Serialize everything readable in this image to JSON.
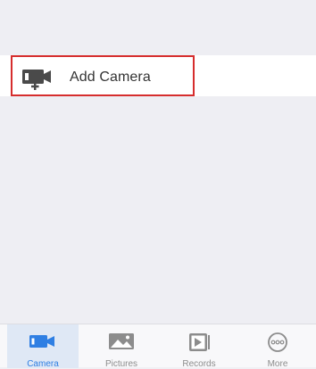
{
  "add_camera": {
    "label": "Add Camera",
    "icon": "camera-plus-icon",
    "highlight_color": "#d62d2d"
  },
  "tabbar": {
    "active_color": "#2f7fe3",
    "inactive_color": "#8c8c8c",
    "tabs": [
      {
        "label": "Camera",
        "icon": "video-camera-icon",
        "active": true
      },
      {
        "label": "Pictures",
        "icon": "picture-icon",
        "active": false
      },
      {
        "label": "Records",
        "icon": "play-record-icon",
        "active": false
      },
      {
        "label": "More",
        "icon": "more-icon",
        "active": false
      }
    ]
  }
}
